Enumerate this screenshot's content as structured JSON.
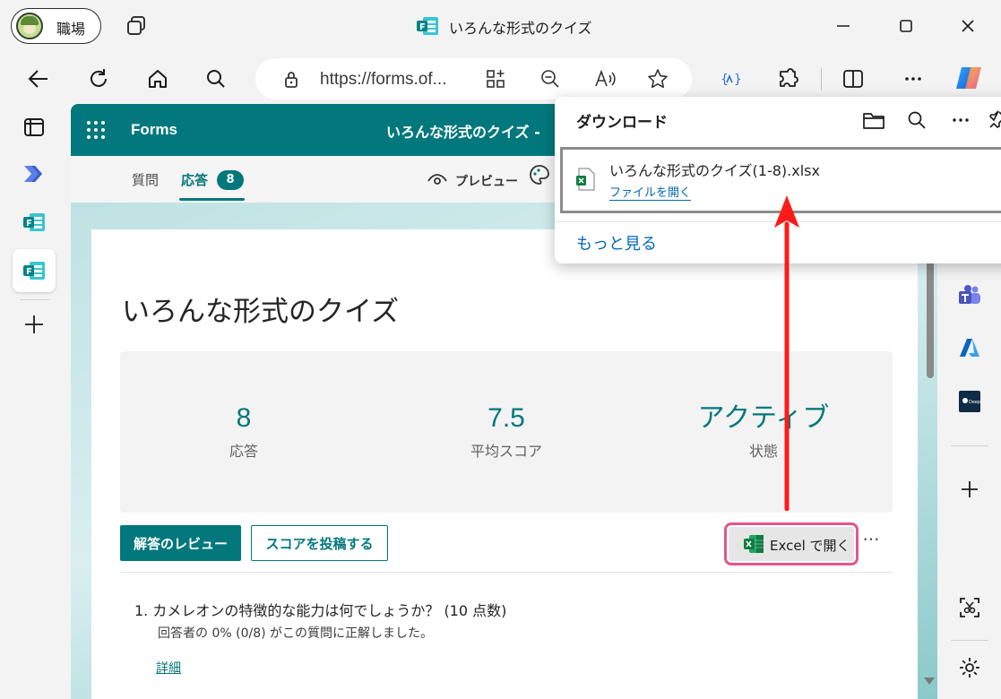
{
  "browser": {
    "profile_label": "職場",
    "window_title": "いろんな形式のクイズ",
    "url": "https://forms.of..."
  },
  "forms": {
    "brand": "Forms",
    "header_title": "いろんな形式のクイズ -",
    "tabs": [
      {
        "label": "質問"
      },
      {
        "label": "応答"
      }
    ],
    "response_count": "8",
    "preview_label": "プレビュー",
    "quiz_title": "いろんな形式のクイズ",
    "stats": [
      {
        "value": "8",
        "label": "応答"
      },
      {
        "value": "7.5",
        "label": "平均スコア"
      },
      {
        "value": "アクティブ",
        "label": "状態"
      }
    ],
    "review_button": "解答のレビュー",
    "post_score_button": "スコアを投稿する",
    "open_excel_button": "Excel で開く",
    "more_label": "···",
    "question": {
      "text": "1.  カメレオンの特徴的な能力は何でしょうか？ (10 点数)",
      "result": "回答者の 0% (0/8) がこの質問に正解しました。",
      "detail_link": "詳細"
    }
  },
  "downloads": {
    "title": "ダウンロード",
    "file_name": "いろんな形式のクイズ(1-8).xlsx",
    "open_file": "ファイルを開く",
    "see_more": "もっと見る"
  },
  "colors": {
    "forms_teal": "#03787c",
    "highlight_pink": "#e2558f",
    "annotation_red": "#ff1a1a",
    "link_blue": "#0067b8"
  },
  "icons": [
    "tabs-icon",
    "forms-icon",
    "minimize-icon",
    "maximize-icon",
    "close-icon",
    "back-icon",
    "refresh-icon",
    "home-icon",
    "search-icon",
    "lock-icon",
    "app-available-icon",
    "zoom-out-icon",
    "read-aloud-icon",
    "favorite-icon",
    "extension-icon",
    "puzzle-icon",
    "split-screen-icon",
    "more-icon",
    "copilot-icon",
    "waffle-icon",
    "eye-icon",
    "excel-icon",
    "folder-icon",
    "pin-icon",
    "teams-icon",
    "azure-icon",
    "deepl-icon",
    "plus-icon",
    "screenshot-icon",
    "gear-icon"
  ]
}
